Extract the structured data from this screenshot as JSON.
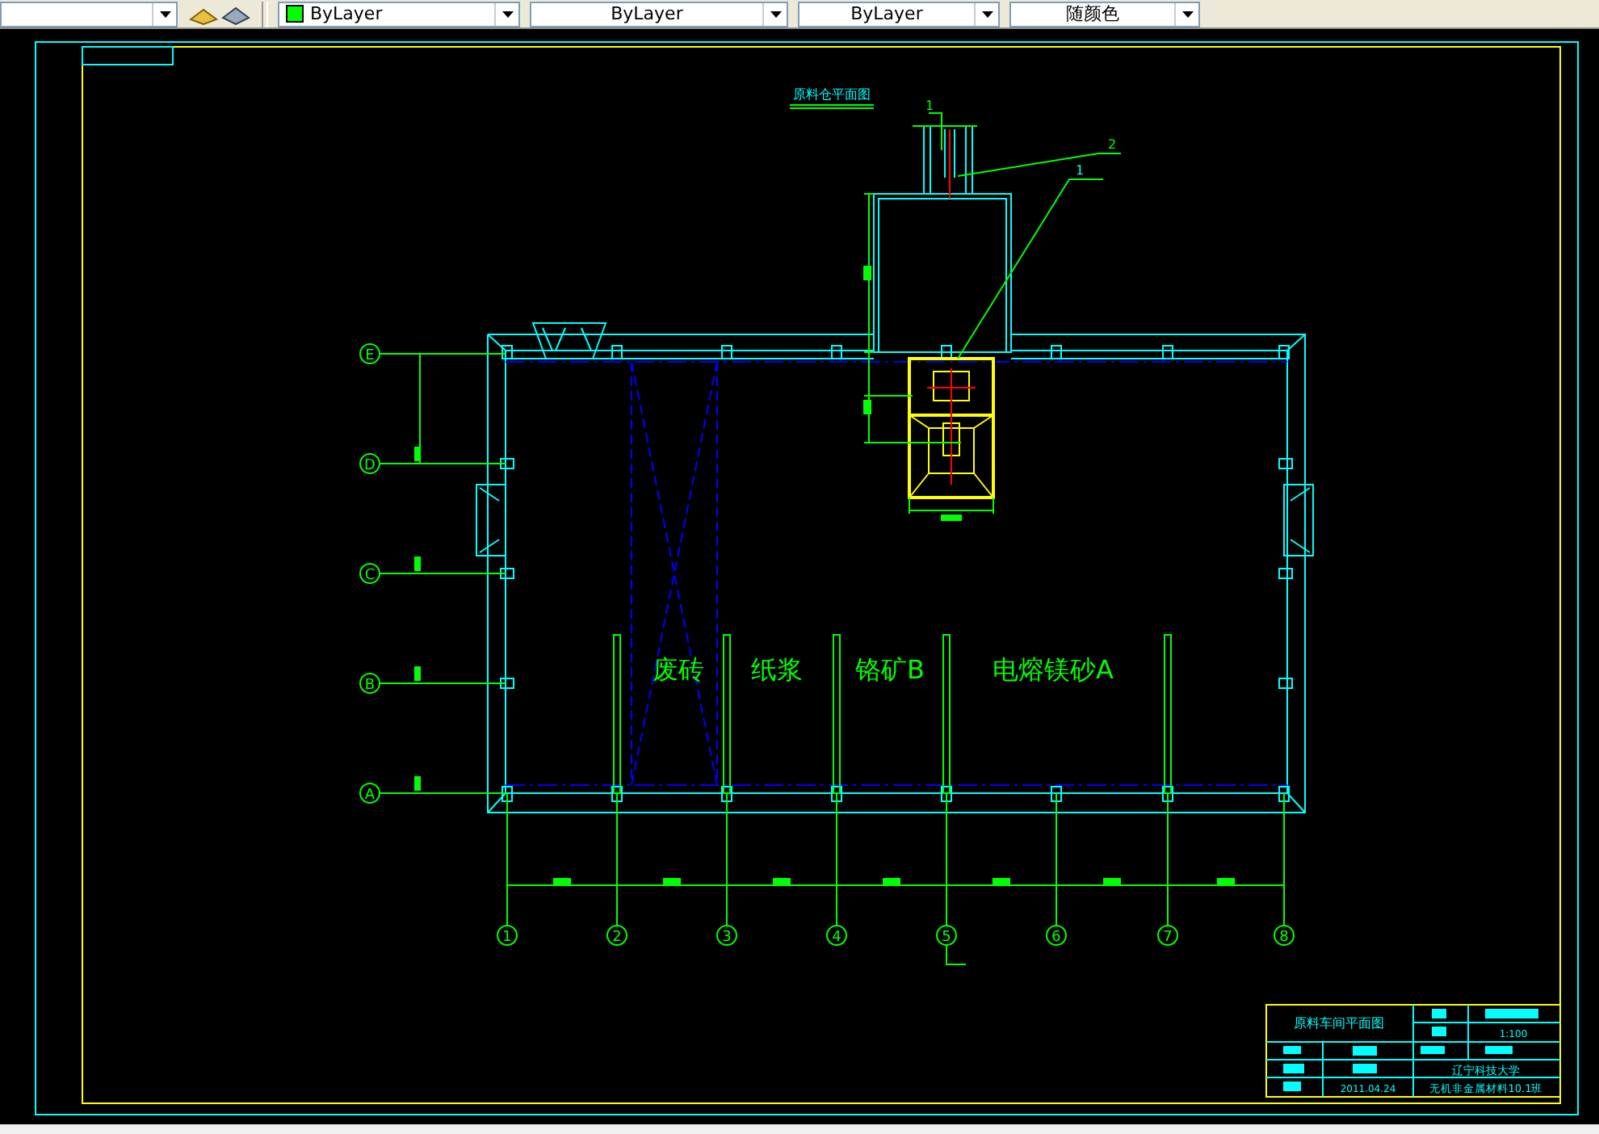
{
  "toolbar": {
    "dropdowns": [
      {
        "label": "ByLayer",
        "color": "#00ff00"
      },
      {
        "label": "ByLayer"
      },
      {
        "label": "ByLayer"
      },
      {
        "label": "随颜色"
      }
    ]
  },
  "drawing": {
    "plan_title": "原料仓平面图",
    "leader_labels": [
      "1",
      "2",
      "1"
    ],
    "row_axes": [
      "E",
      "D",
      "C",
      "B",
      "A"
    ],
    "column_axes": [
      "1",
      "2",
      "3",
      "4",
      "5",
      "6",
      "7",
      "8"
    ],
    "material_labels": [
      "废砖",
      "纸浆",
      "铬矿B",
      "电熔镁砂A"
    ]
  },
  "title_block": {
    "drawing_title": "原料车间平面图",
    "scale": "1:100",
    "school": "辽宁科技大学",
    "date": "2011.04.24",
    "class": "无机非金属材料10.1班"
  }
}
